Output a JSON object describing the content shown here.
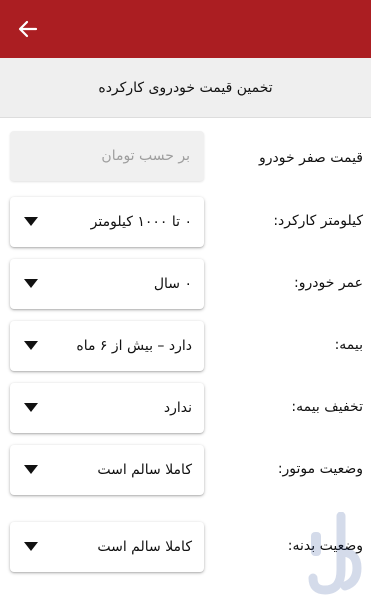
{
  "app": {
    "accent_color": "#ab1e22",
    "back_icon": "arrow-left-icon"
  },
  "header": {
    "title": "تخمین قیمت خودروی کارکرده"
  },
  "form": {
    "base_price": {
      "label": "قیمت صفر خودرو",
      "placeholder": "بر حسب تومان"
    },
    "mileage": {
      "label": "کیلومتر کارکرد:",
      "value": "۰ تا ۱۰۰۰ کیلومتر"
    },
    "age": {
      "label": "عمر خودرو:",
      "value": "۰ سال"
    },
    "insurance": {
      "label": "بیمه:",
      "value": "دارد – بیش از ۶ ماه"
    },
    "insurance_discount": {
      "label": "تخفیف بیمه:",
      "value": "ندارد"
    },
    "engine_status": {
      "label": "وضعیت موتور:",
      "value": "کاملا سالم است"
    },
    "body_status": {
      "label": "وضعیت بدنه:",
      "value": "کاملا سالم است"
    }
  }
}
